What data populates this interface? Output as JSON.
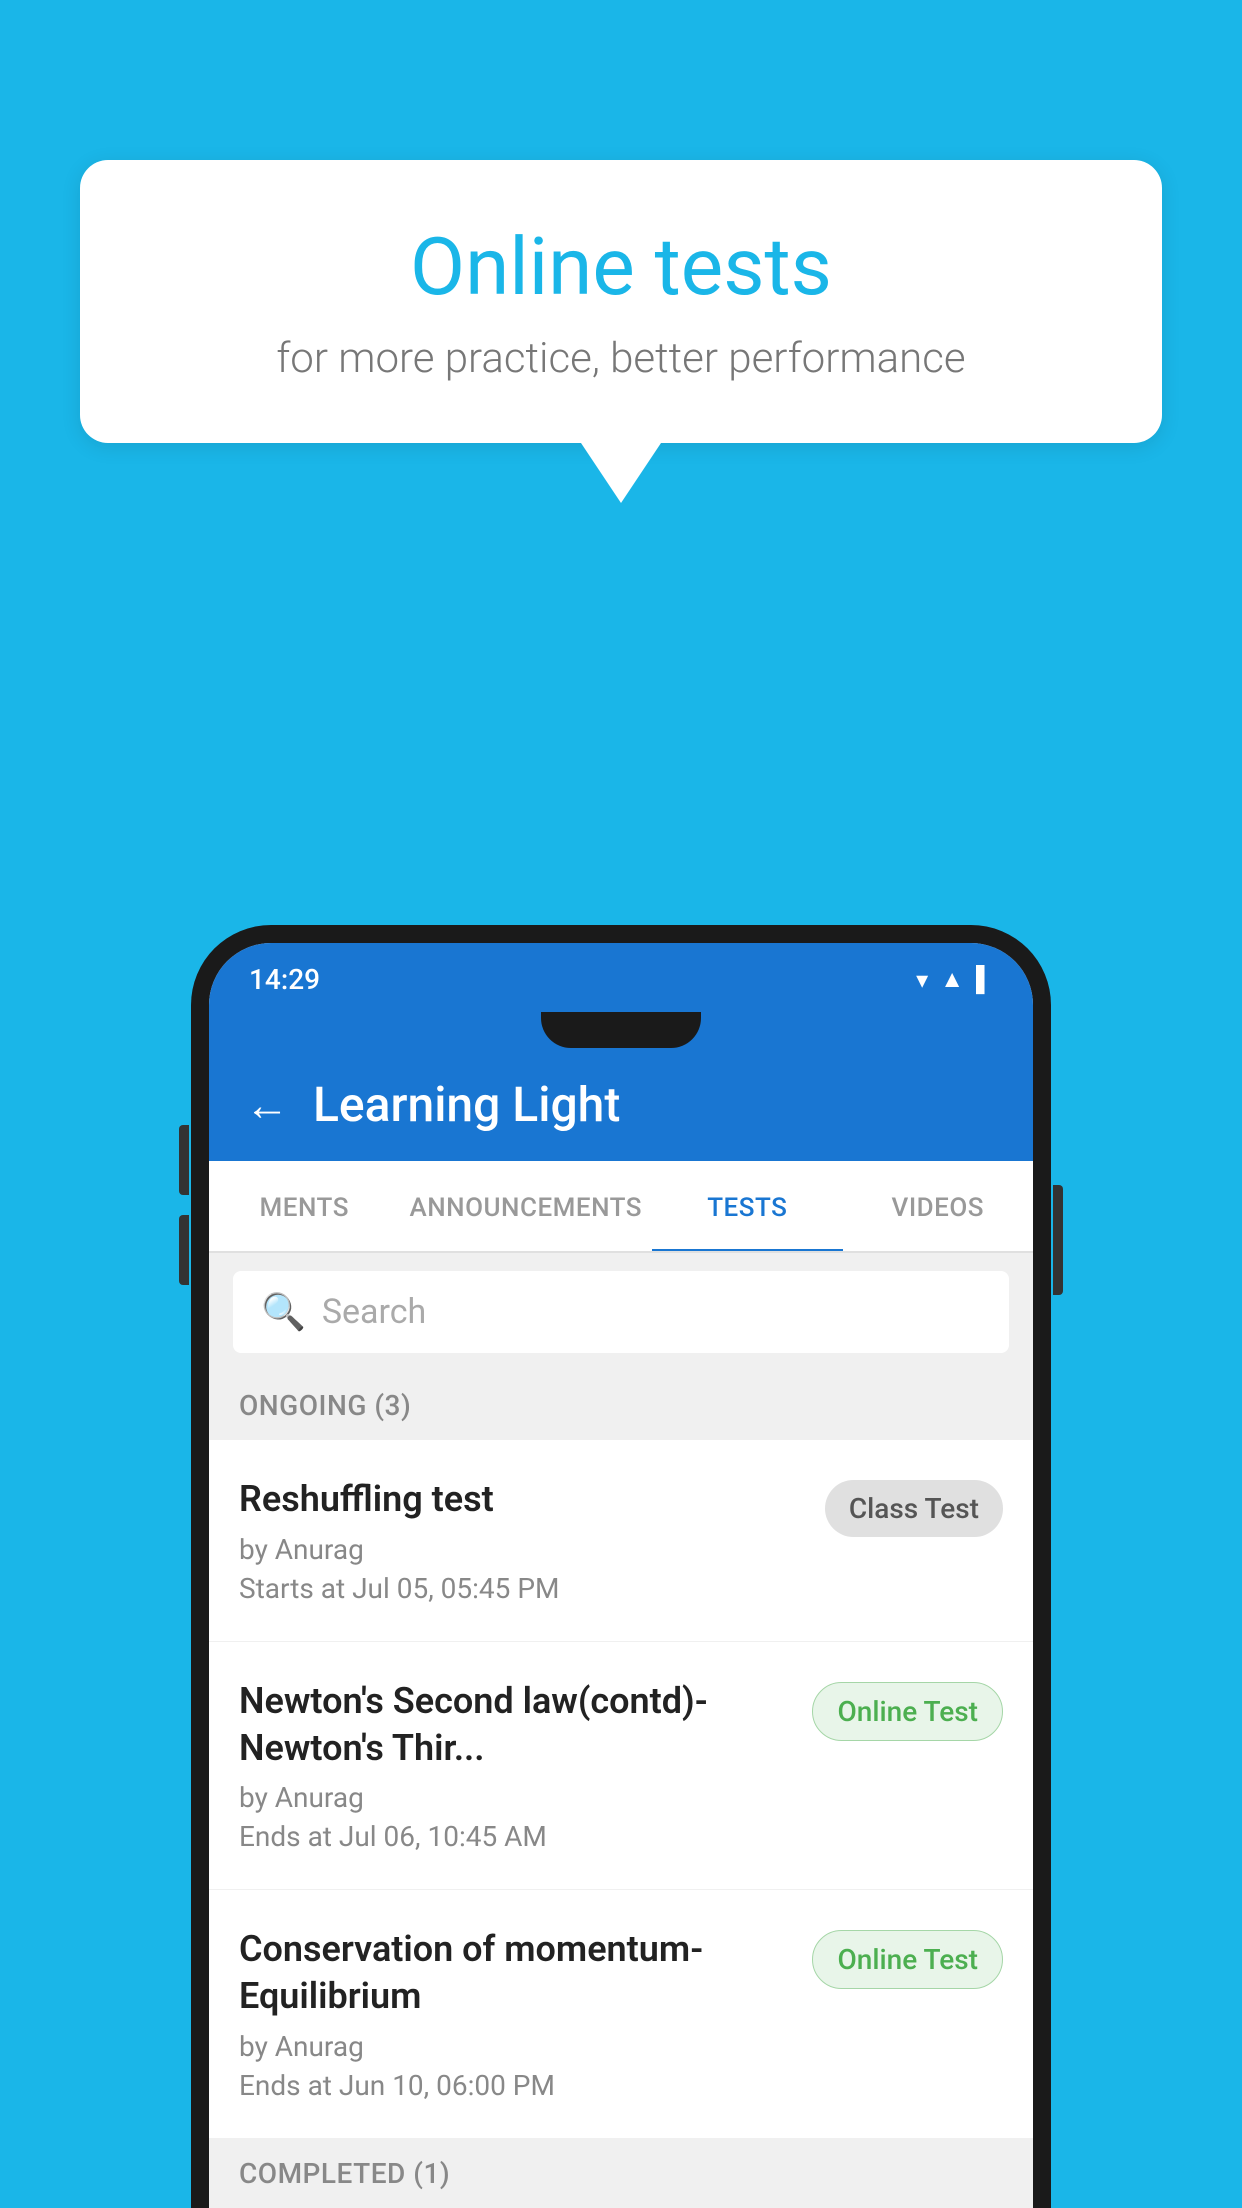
{
  "background": {
    "color": "#1ab6e8"
  },
  "speech_bubble": {
    "title": "Online tests",
    "subtitle": "for more practice, better performance"
  },
  "phone": {
    "status_bar": {
      "time": "14:29",
      "icons": "▼◀▌"
    },
    "app_bar": {
      "back_label": "←",
      "title": "Learning Light"
    },
    "tabs": [
      {
        "label": "MENTS",
        "active": false
      },
      {
        "label": "ANNOUNCEMENTS",
        "active": false
      },
      {
        "label": "TESTS",
        "active": true
      },
      {
        "label": "VIDEOS",
        "active": false
      }
    ],
    "search": {
      "placeholder": "Search"
    },
    "sections": [
      {
        "label": "ONGOING (3)",
        "items": [
          {
            "name": "Reshuffling test",
            "by": "by Anurag",
            "date": "Starts at  Jul 05, 05:45 PM",
            "badge": "Class Test",
            "badge_type": "class"
          },
          {
            "name": "Newton's Second law(contd)-Newton's Thir...",
            "by": "by Anurag",
            "date": "Ends at  Jul 06, 10:45 AM",
            "badge": "Online Test",
            "badge_type": "online"
          },
          {
            "name": "Conservation of momentum-Equilibrium",
            "by": "by Anurag",
            "date": "Ends at  Jun 10, 06:00 PM",
            "badge": "Online Test",
            "badge_type": "online"
          }
        ]
      },
      {
        "label": "COMPLETED (1)",
        "items": []
      }
    ]
  }
}
